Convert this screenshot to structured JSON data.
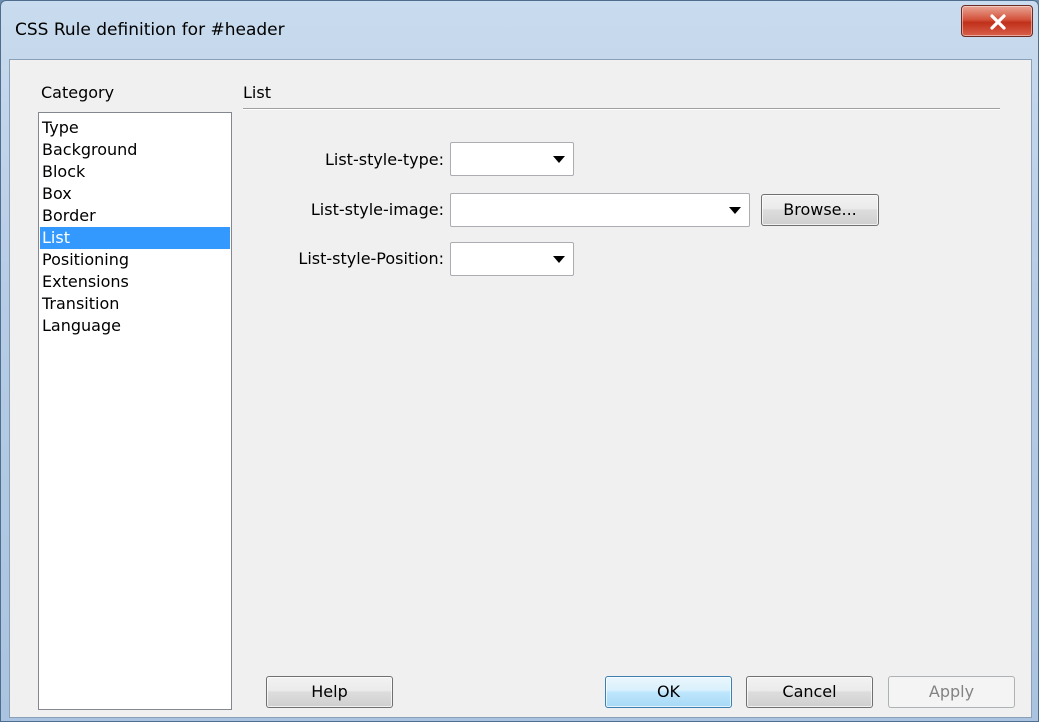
{
  "window": {
    "title": "CSS Rule definition for #header"
  },
  "category": {
    "label": "Category",
    "items": [
      "Type",
      "Background",
      "Block",
      "Box",
      "Border",
      "List",
      "Positioning",
      "Extensions",
      "Transition",
      "Language"
    ],
    "selected": "List"
  },
  "section": {
    "title": "List"
  },
  "fields": {
    "list_style_type": {
      "label": "List-style-type:",
      "value": ""
    },
    "list_style_image": {
      "label": "List-style-image:",
      "value": "",
      "browse_label": "Browse..."
    },
    "list_style_position": {
      "label": "List-style-Position:",
      "value": ""
    }
  },
  "buttons": {
    "help": "Help",
    "ok": "OK",
    "cancel": "Cancel",
    "apply": "Apply"
  },
  "icons": {
    "close": "close-icon",
    "dropdown": "chevron-down-icon"
  },
  "colors": {
    "selection": "#3399ff",
    "close_button": "#c0301a",
    "title_bar": "#b7cde6"
  }
}
